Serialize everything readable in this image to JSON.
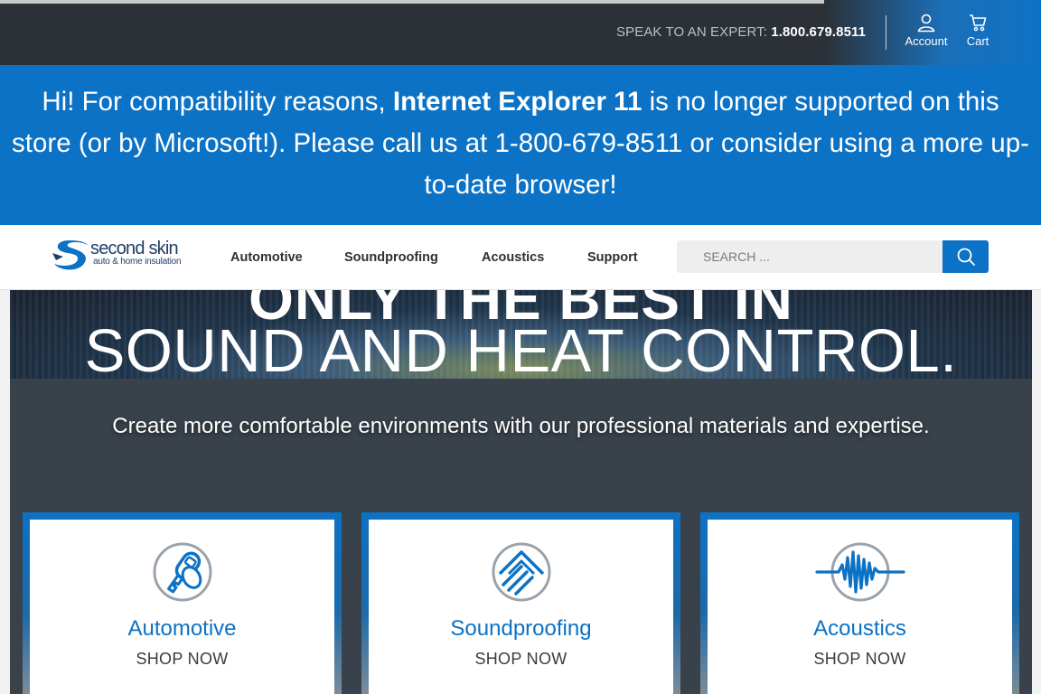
{
  "topbar": {
    "expert_label": "SPEAK TO AN EXPERT: ",
    "phone": "1.800.679.8511",
    "account_label": "Account",
    "cart_label": "Cart"
  },
  "banner": {
    "part1": "Hi! For compatibility reasons, ",
    "highlight": "Internet Explorer 11",
    "part2": " is no longer supported on this store (or by Microsoft!). Please call us at 1-800-679-8511 or consider using a more up-to-date browser!"
  },
  "logo": {
    "name": "second skin",
    "tagline": "auto & home insulation"
  },
  "nav": {
    "items": [
      "Automotive",
      "Soundproofing",
      "Acoustics",
      "Support"
    ]
  },
  "search": {
    "placeholder": "SEARCH ..."
  },
  "hero": {
    "line1": "ONLY THE BEST IN",
    "line2": "SOUND AND HEAT CONTROL.",
    "subtitle": "Create more comfortable environments with our professional materials and expertise."
  },
  "cards": [
    {
      "title": "Automotive",
      "cta": "SHOP NOW",
      "icon": "car-key-icon"
    },
    {
      "title": "Soundproofing",
      "cta": "SHOP NOW",
      "icon": "roof-layers-icon"
    },
    {
      "title": "Acoustics",
      "cta": "SHOP NOW",
      "icon": "sound-wave-icon"
    }
  ],
  "colors": {
    "brand_blue": "#0c72c5",
    "topbar_dark": "#2b3137",
    "hero_dark": "#39414a"
  }
}
